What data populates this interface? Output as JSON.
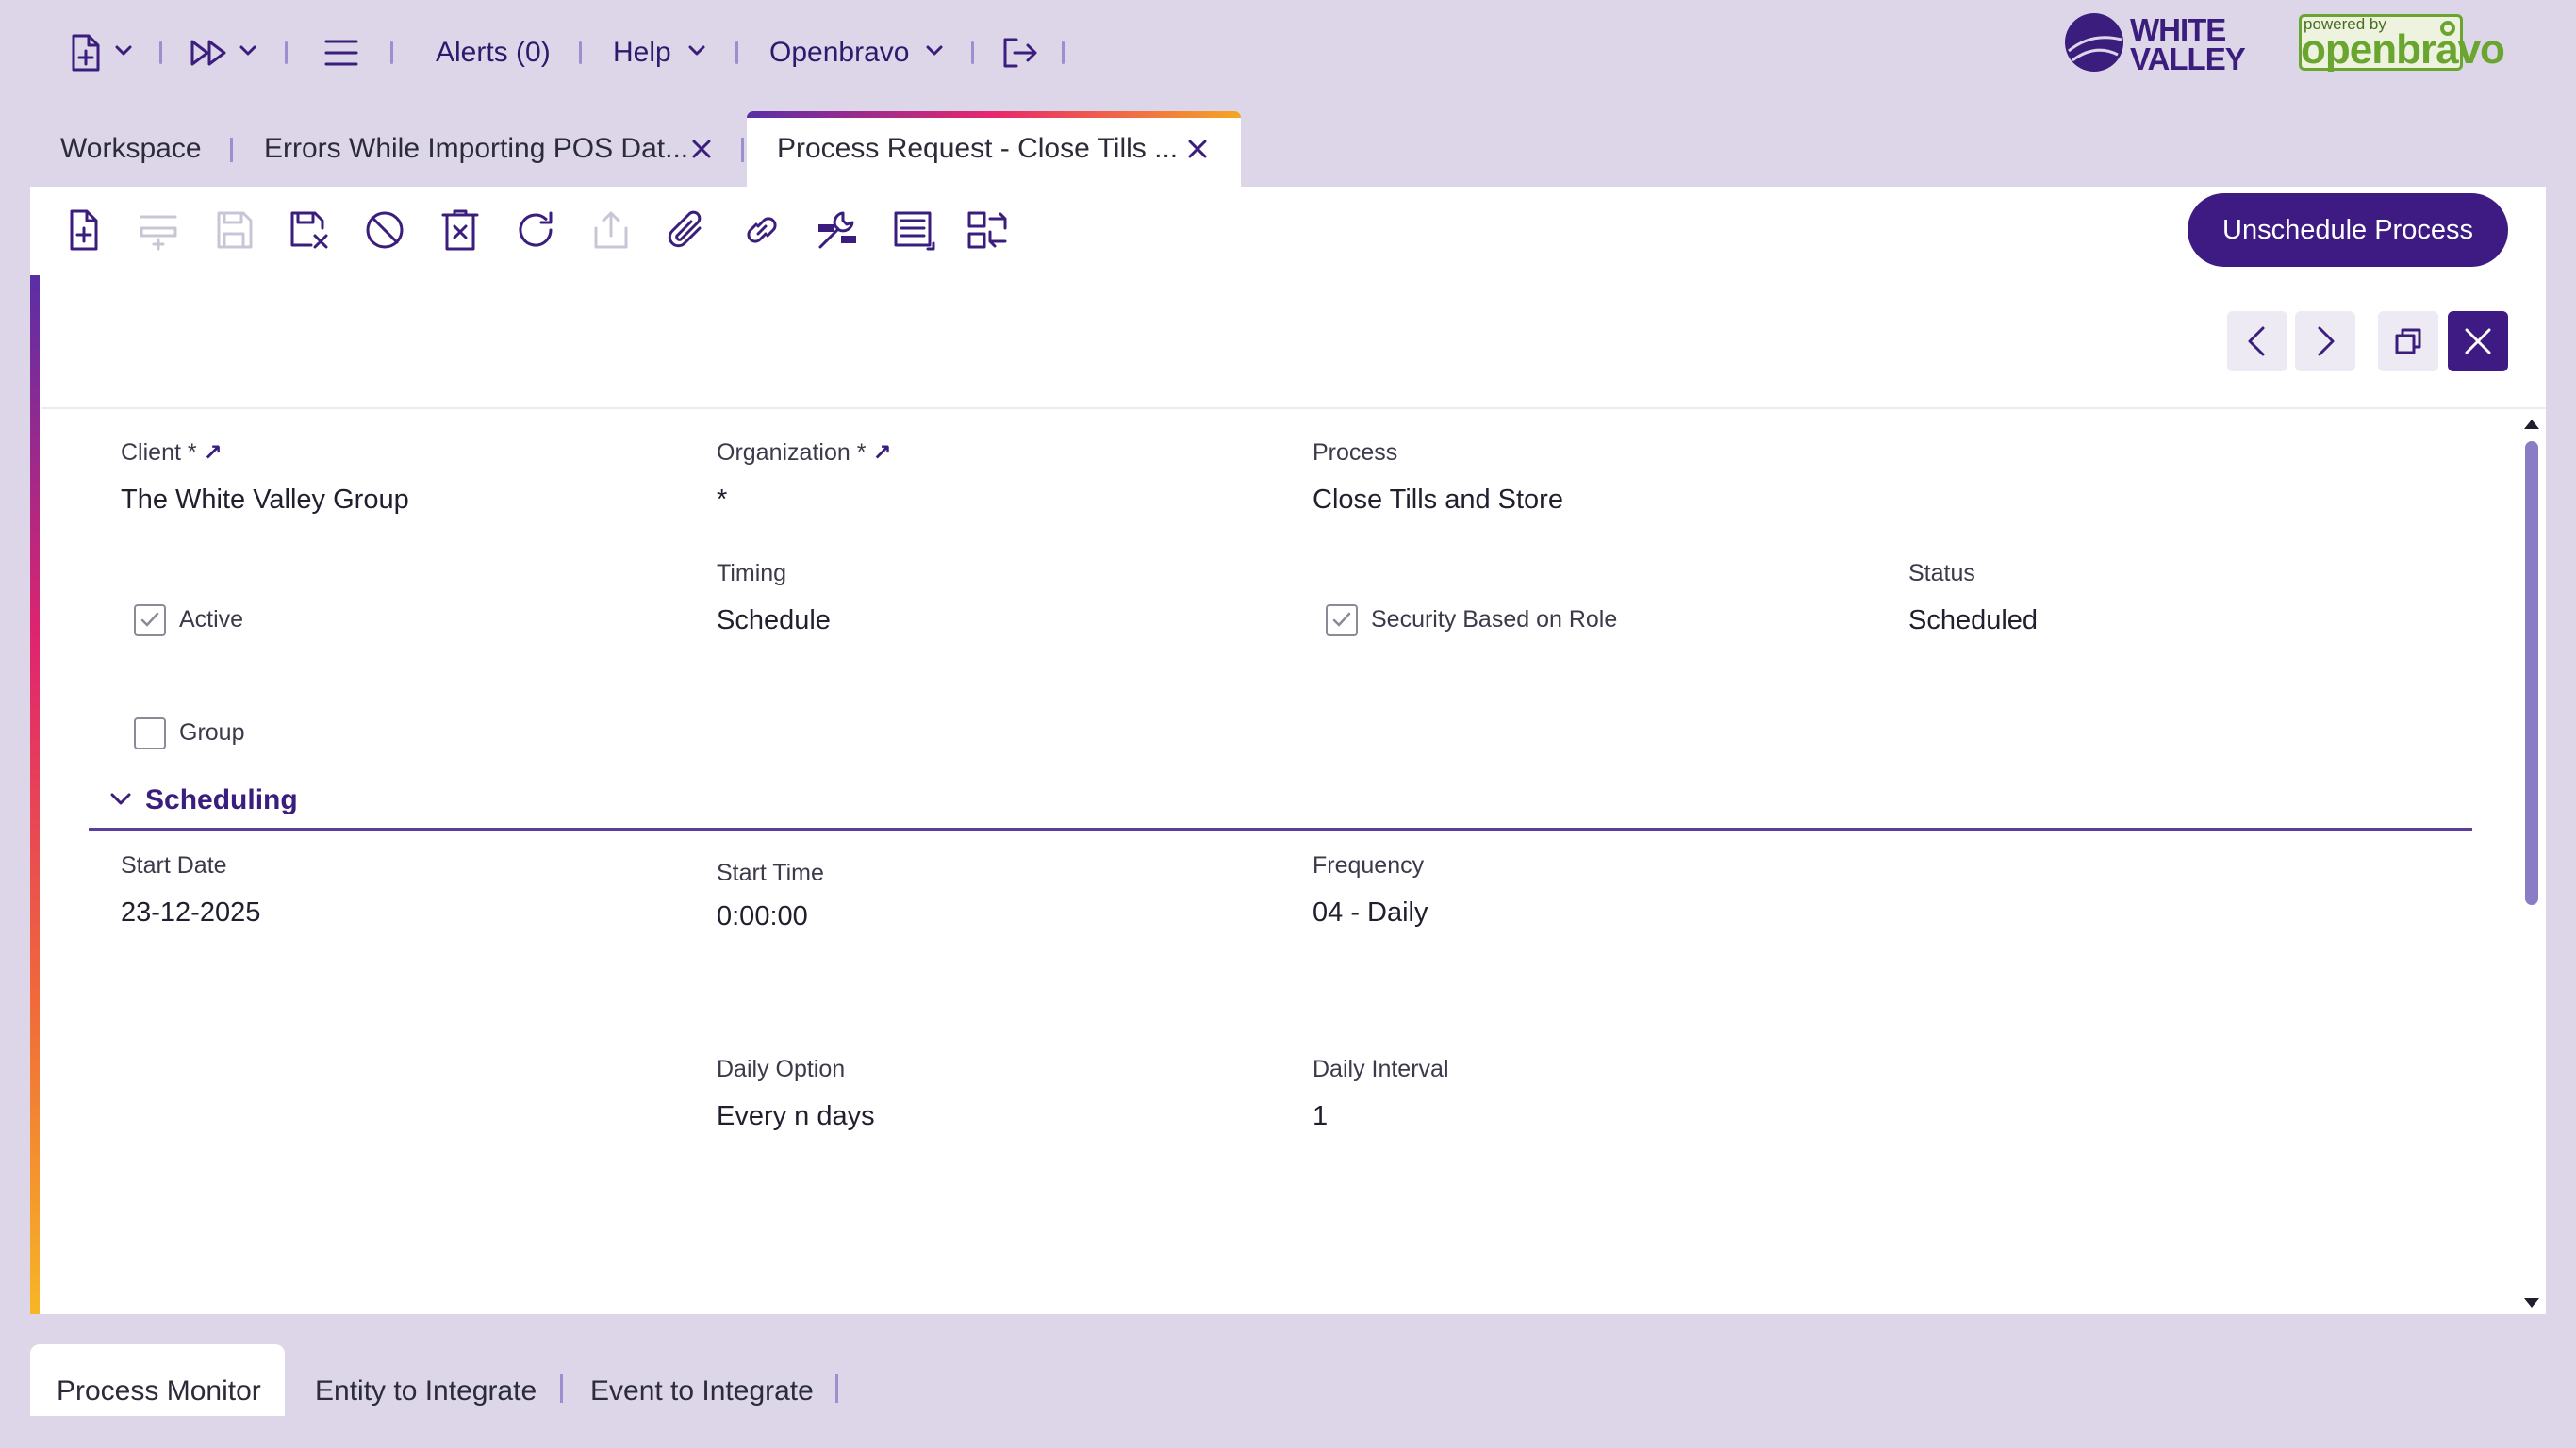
{
  "topnav": {
    "alerts_label": "Alerts (0)",
    "help_label": "Help",
    "user_label": "Openbravo"
  },
  "logos": {
    "brand_line1": "WHITE",
    "brand_line2": "VALLEY",
    "powered_by": "powered by",
    "openbravo": "openbravo"
  },
  "tabs": [
    {
      "label": "Workspace"
    },
    {
      "label": "Errors While Importing POS Dat..."
    },
    {
      "label": "Process Request - Close Tills ..."
    }
  ],
  "toolbar": {
    "primary_button": "Unschedule Process"
  },
  "form": {
    "client_label": "Client *",
    "client_value": "The White Valley Group",
    "organization_label": "Organization *",
    "organization_value": "*",
    "process_label": "Process",
    "process_value": "Close Tills and Store",
    "active_label": "Active",
    "timing_label": "Timing",
    "timing_value": "Schedule",
    "security_label": "Security Based on Role",
    "status_label": "Status",
    "status_value": "Scheduled",
    "group_label": "Group"
  },
  "scheduling": {
    "section_title": "Scheduling",
    "start_date_label": "Start Date",
    "start_date_value": "23-12-2025",
    "start_time_label": "Start Time",
    "start_time_value": "0:00:00",
    "frequency_label": "Frequency",
    "frequency_value": "04 - Daily",
    "daily_option_label": "Daily Option",
    "daily_option_value": "Every n days",
    "daily_interval_label": "Daily Interval",
    "daily_interval_value": "1"
  },
  "bottom_tabs": [
    {
      "label": "Process Monitor"
    },
    {
      "label": "Entity to Integrate"
    },
    {
      "label": "Event to Integrate"
    }
  ],
  "colors": {
    "accent": "#3d1b82",
    "background": "#dcd6e8",
    "openbravo_green": "#6aa530"
  }
}
